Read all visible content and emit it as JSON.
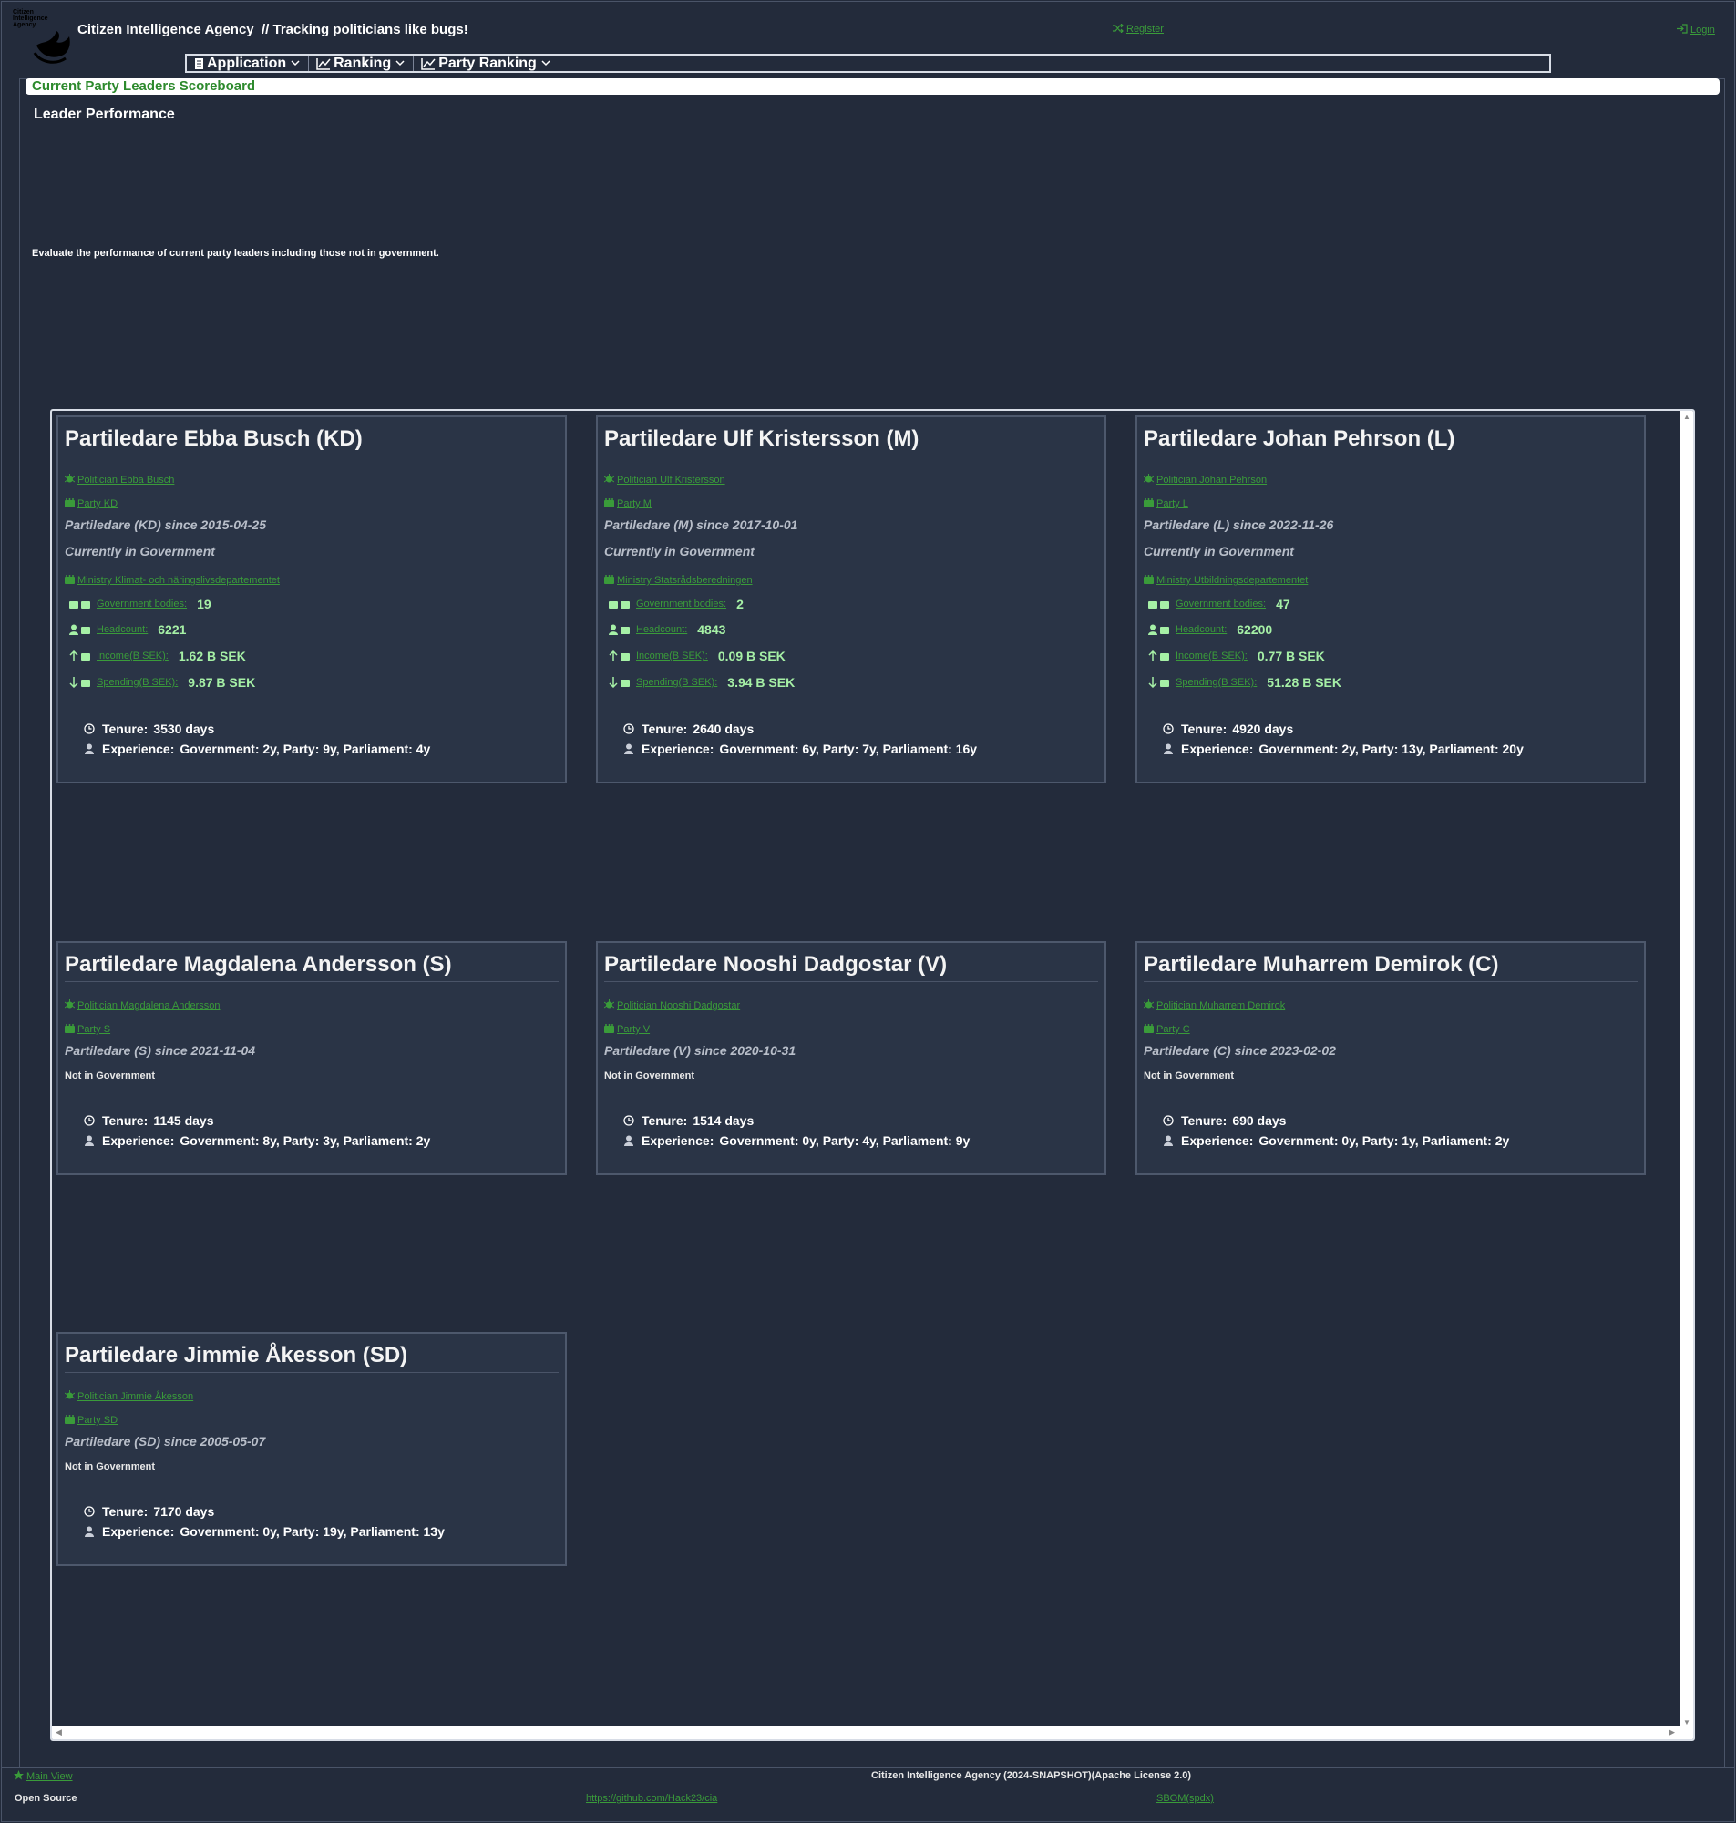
{
  "header": {
    "logo_text": "Citizen Intelligence Agency",
    "title": "Citizen Intelligence Agency",
    "tagline": "// Tracking politicians like bugs!",
    "register": "Register",
    "login": "Login"
  },
  "menu": {
    "items": [
      {
        "label": "Application",
        "icon": "document-icon"
      },
      {
        "label": "Ranking",
        "icon": "line-chart-icon"
      },
      {
        "label": "Party Ranking",
        "icon": "line-chart-icon"
      }
    ]
  },
  "page": {
    "title": "Current Party Leaders Scoreboard",
    "section_heading": "Leader Performance",
    "description": "Evaluate the performance of current party leaders including those not in government."
  },
  "labels": {
    "government_bodies": "Government bodies:",
    "headcount": "Headcount:",
    "income": "Income(B SEK):",
    "spending": "Spending(B SEK):",
    "tenure": "Tenure:",
    "experience": "Experience:"
  },
  "leaders": [
    {
      "title": "Partiledare Ebba Busch (KD)",
      "politician_link": "Politician Ebba Busch",
      "party_link": "Party KD",
      "since": "Partiledare (KD) since 2015-04-25",
      "status": "Currently in Government",
      "ministry": "Ministry Klimat- och näringslivsdepartementet",
      "government_bodies": "19",
      "headcount": "6221",
      "income": "1.62 B SEK",
      "spending": "9.87 B SEK",
      "tenure": "3530 days",
      "experience": "Government: 2y, Party: 9y, Parliament: 4y"
    },
    {
      "title": "Partiledare Ulf Kristersson (M)",
      "politician_link": "Politician Ulf Kristersson",
      "party_link": "Party M",
      "since": "Partiledare (M) since 2017-10-01",
      "status": "Currently in Government",
      "ministry": "Ministry Statsrådsberedningen",
      "government_bodies": "2",
      "headcount": "4843",
      "income": "0.09 B SEK",
      "spending": "3.94 B SEK",
      "tenure": "2640 days",
      "experience": "Government: 6y, Party: 7y, Parliament: 16y"
    },
    {
      "title": "Partiledare Johan Pehrson (L)",
      "politician_link": "Politician Johan Pehrson",
      "party_link": "Party L",
      "since": "Partiledare (L) since 2022-11-26",
      "status": "Currently in Government",
      "ministry": "Ministry Utbildningsdepartementet",
      "government_bodies": "47",
      "headcount": "62200",
      "income": "0.77 B SEK",
      "spending": "51.28 B SEK",
      "tenure": "4920 days",
      "experience": "Government: 2y, Party: 13y, Parliament: 20y"
    },
    {
      "title": "Partiledare Magdalena Andersson (S)",
      "politician_link": "Politician Magdalena Andersson",
      "party_link": "Party S",
      "since": "Partiledare (S) since 2021-11-04",
      "status": "Not in Government",
      "tenure": "1145 days",
      "experience": "Government: 8y, Party: 3y, Parliament: 2y"
    },
    {
      "title": "Partiledare Nooshi Dadgostar (V)",
      "politician_link": "Politician Nooshi Dadgostar",
      "party_link": "Party V",
      "since": "Partiledare (V) since 2020-10-31",
      "status": "Not in Government",
      "tenure": "1514 days",
      "experience": "Government: 0y, Party: 4y, Parliament: 9y"
    },
    {
      "title": "Partiledare Muharrem Demirok (C)",
      "politician_link": "Politician Muharrem Demirok",
      "party_link": "Party C",
      "since": "Partiledare (C) since 2023-02-02",
      "status": "Not in Government",
      "tenure": "690 days",
      "experience": "Government: 0y, Party: 1y, Parliament: 2y"
    },
    {
      "title": "Partiledare Jimmie Åkesson (SD)",
      "politician_link": "Politician Jimmie Åkesson",
      "party_link": "Party SD",
      "since": "Partiledare (SD) since 2005-05-07",
      "status": "Not in Government",
      "tenure": "7170 days",
      "experience": "Government: 0y, Party: 19y, Parliament: 13y"
    }
  ],
  "footer": {
    "main_view": "Main View",
    "copyright": "Citizen Intelligence Agency (2024-SNAPSHOT)(Apache License 2.0)",
    "open_source": "Open Source",
    "github": "https://github.com/Hack23/cia",
    "sbom": "SBOM(spdx)"
  },
  "colors": {
    "background": "#232b3b",
    "card": "#2a3446",
    "link_green": "#3a9b3a",
    "value_green": "#a6f0a6",
    "title_bar_text": "#2d8a2d"
  }
}
